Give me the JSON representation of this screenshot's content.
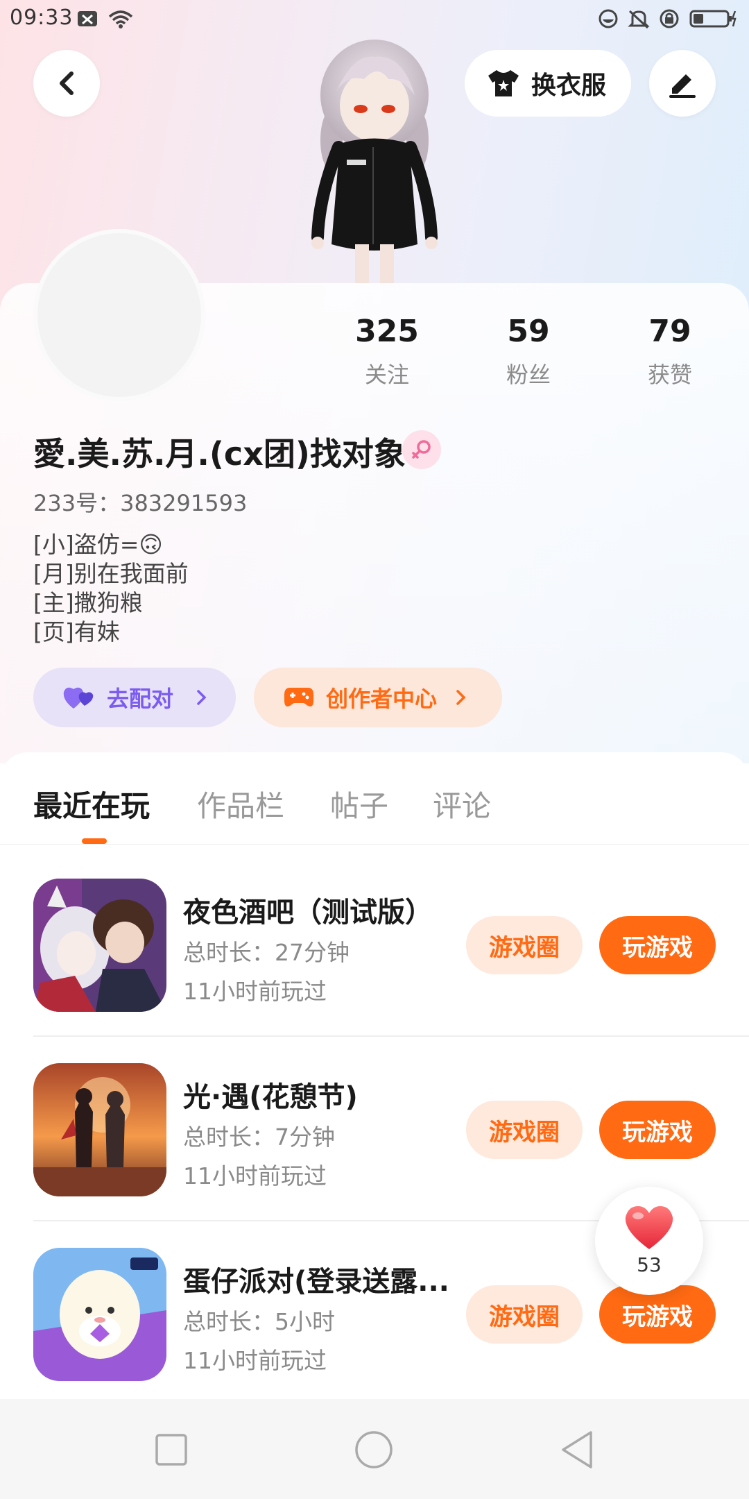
{
  "status_bar": {
    "time": "09:33"
  },
  "header": {
    "back_icon": "chevron-left-icon",
    "outfit_label": "换衣服",
    "edit_icon": "pencil-icon"
  },
  "profile": {
    "stats": [
      {
        "value": "325",
        "label": "关注"
      },
      {
        "value": "59",
        "label": "粉丝"
      },
      {
        "value": "79",
        "label": "获赞"
      }
    ],
    "nickname": "愛.美.苏.月.(cx团)找对象",
    "uid": "233号：383291593",
    "bio": [
      "[小]盗仿=🙃",
      "[月]别在我面前",
      "[主]撒狗粮",
      "[页]有妹"
    ],
    "match_label": "去配对",
    "creator_label": "创作者中心"
  },
  "tabs": [
    {
      "label": "最近在玩",
      "active": true
    },
    {
      "label": "作品栏",
      "active": false
    },
    {
      "label": "帖子",
      "active": false
    },
    {
      "label": "评论",
      "active": false
    }
  ],
  "games": [
    {
      "title": "夜色酒吧（测试版）",
      "duration": "总时长：27分钟",
      "last_played": "11小时前玩过",
      "circle_label": "游戏圈",
      "play_label": "玩游戏"
    },
    {
      "title": "光·遇(花憩节)",
      "duration": "总时长：7分钟",
      "last_played": "11小时前玩过",
      "circle_label": "游戏圈",
      "play_label": "玩游戏"
    },
    {
      "title": "蛋仔派对(登录送露...",
      "duration": "总时长：5小时",
      "last_played": "11小时前玩过",
      "circle_label": "游戏圈",
      "play_label": "玩游戏"
    }
  ],
  "like_float": {
    "count": "53"
  },
  "colors": {
    "accent": "#ff6a13",
    "accent_light": "#ffe8dc",
    "purple": "#7b5cf0",
    "purple_bg": "#e8e2f8"
  }
}
